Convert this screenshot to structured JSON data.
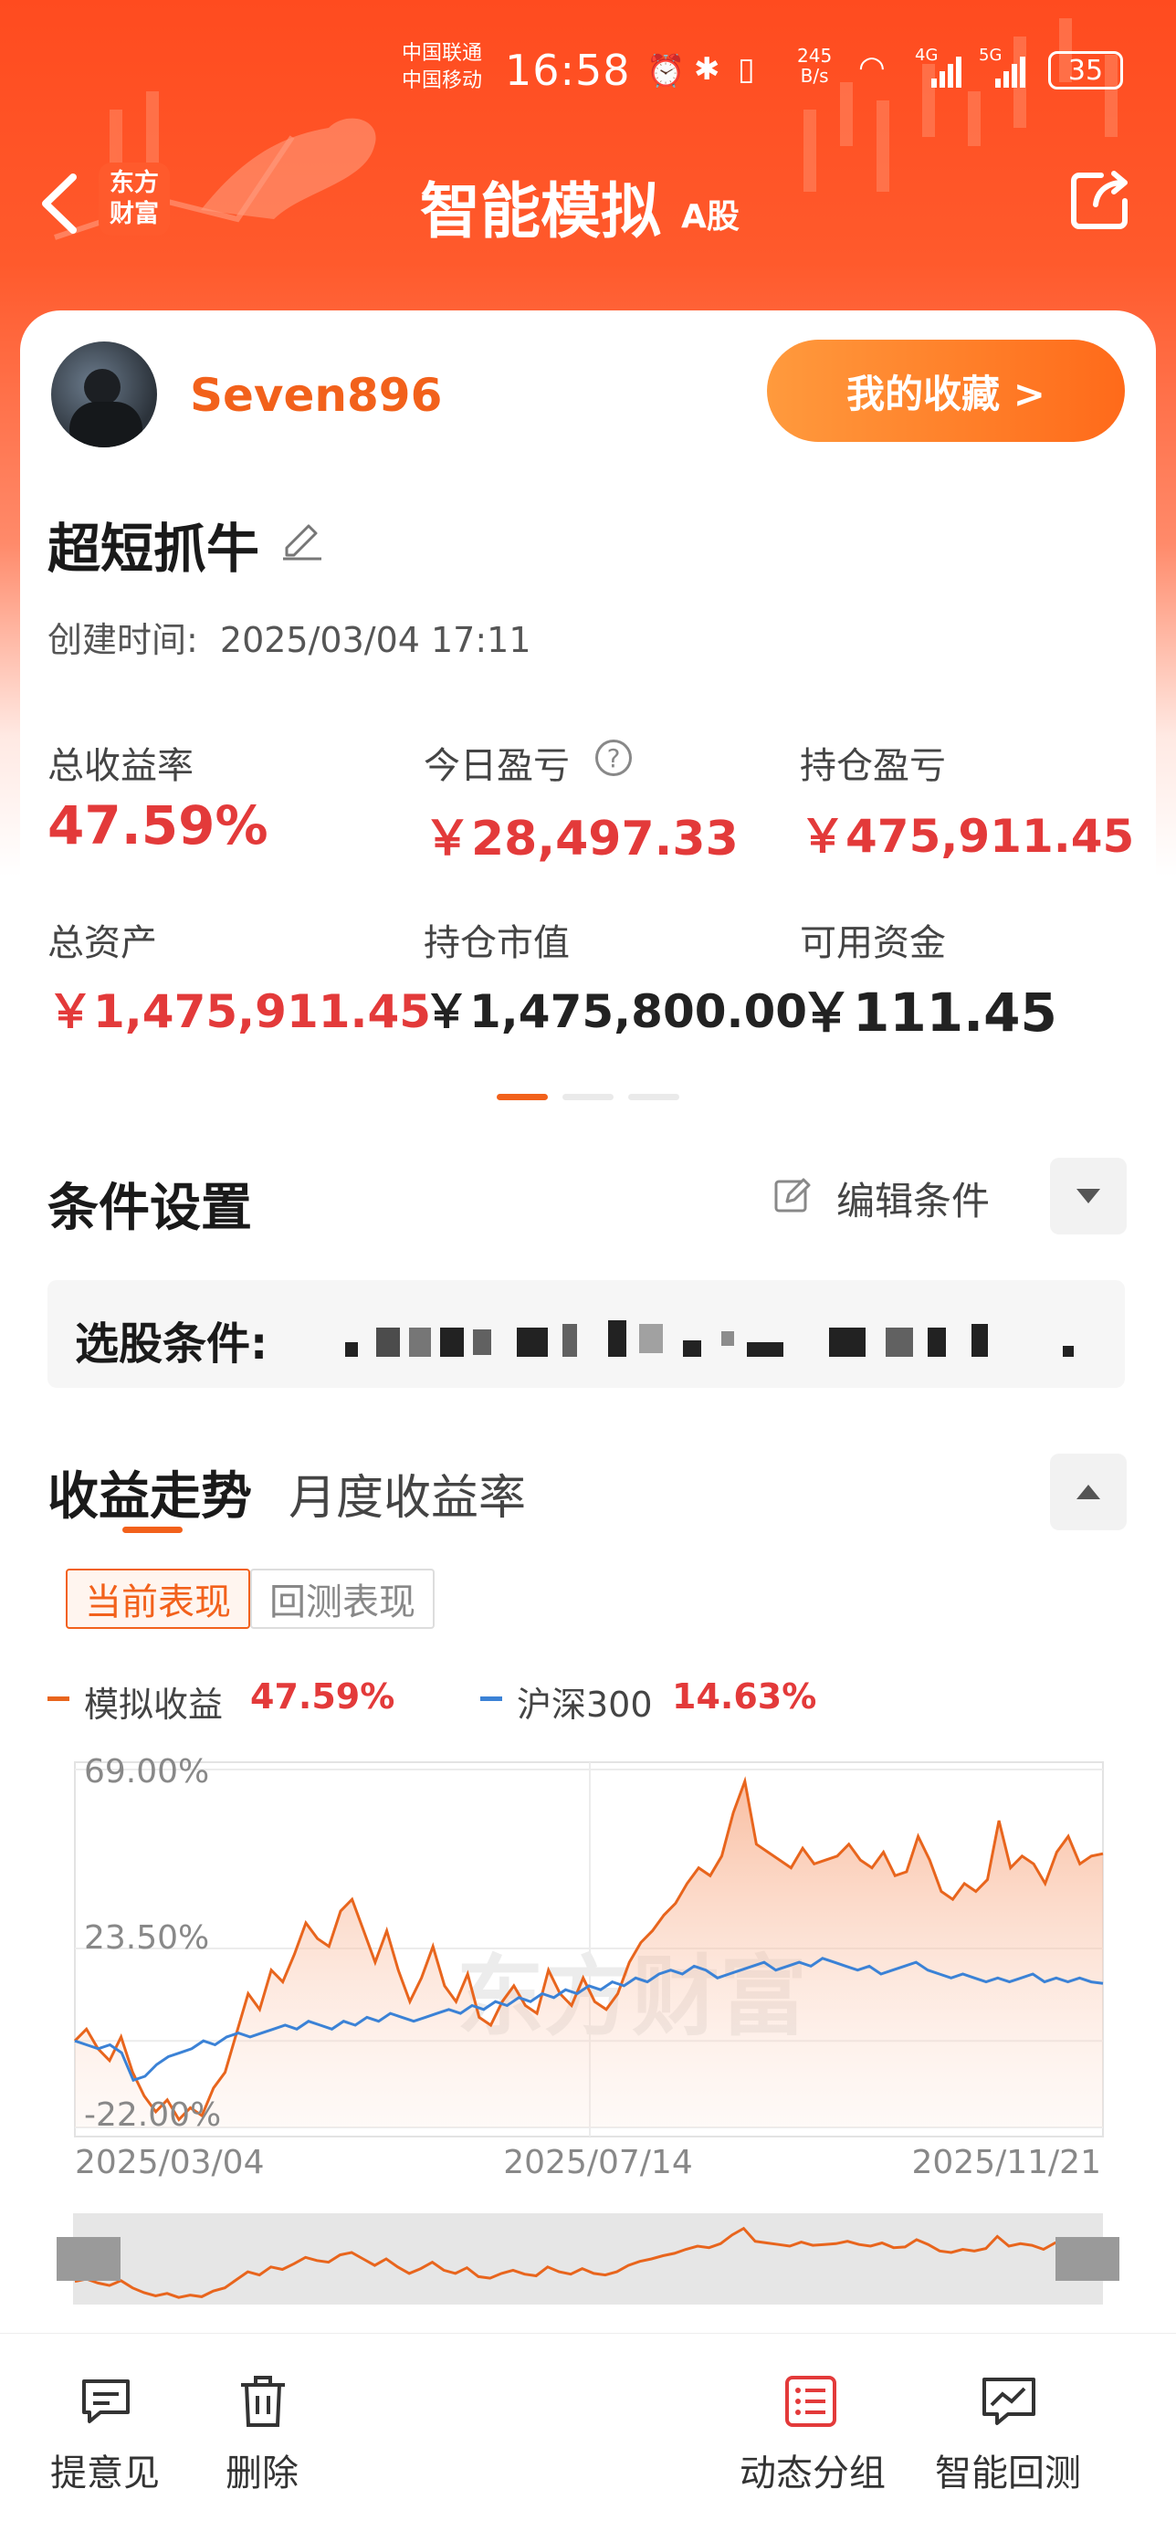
{
  "status_bar": {
    "carrier1": "中国联通",
    "carrier2": "中国移动",
    "time": "16:58",
    "net_speed_top": "245",
    "net_speed_bottom": "B/s",
    "sig1": "4G",
    "sig2": "5G",
    "battery": "35"
  },
  "nav": {
    "logo_line1": "东方",
    "logo_line2": "财富",
    "title": "智能模拟",
    "subtitle": "A股",
    "favorites_label": "我的收藏 >"
  },
  "profile": {
    "username": "Seven896",
    "strategy_name": "超短抓牛",
    "created_label": "创建时间:",
    "created_time": "2025/03/04 17:11"
  },
  "stats": [
    {
      "label": "总收益率",
      "value": "47.59%",
      "style": "red"
    },
    {
      "label": "今日盈亏",
      "value": "￥28,497.33",
      "style": "red"
    },
    {
      "label": "持仓盈亏",
      "value": "￥475,911.45",
      "style": "red"
    },
    {
      "label": "总资产",
      "value": "￥1,475,911.45",
      "style": "red"
    },
    {
      "label": "持仓市值",
      "value": "￥1,475,800.00",
      "style": "black"
    },
    {
      "label": "可用资金",
      "value": "￥111.45",
      "style": "black"
    }
  ],
  "conditions": {
    "title": "条件设置",
    "edit_label": "编辑条件",
    "select_label": "选股条件:"
  },
  "returns": {
    "tab_active": "收益走势",
    "tab_inactive": "月度收益率",
    "btn_current": "当前表现",
    "btn_backtest": "回测表现",
    "legend": [
      {
        "name": "模拟收益",
        "value": "47.59%",
        "color": "#e8651d"
      },
      {
        "name": "沪深300",
        "value": "14.63%",
        "color": "#3b82d6"
      }
    ],
    "watermark": "东方财富"
  },
  "chart_data": {
    "type": "line",
    "y_ticks": [
      "69.00%",
      "23.50%",
      "-22.00%"
    ],
    "x_ticks": [
      "2025/03/04",
      "2025/07/14",
      "2025/11/21"
    ],
    "ylim": [
      -22,
      69
    ],
    "series": [
      {
        "name": "模拟收益",
        "color": "#e8651d",
        "values": [
          0,
          3,
          -2,
          -5,
          1,
          -8,
          -14,
          -18,
          -15,
          -20,
          -17,
          -19,
          -12,
          -8,
          2,
          12,
          8,
          18,
          15,
          22,
          30,
          26,
          24,
          33,
          36,
          28,
          20,
          28,
          18,
          10,
          16,
          24,
          14,
          10,
          17,
          6,
          4,
          10,
          14,
          9,
          7,
          18,
          12,
          9,
          16,
          10,
          8,
          12,
          20,
          25,
          28,
          32,
          35,
          40,
          44,
          42,
          47,
          58,
          66,
          50,
          48,
          46,
          44,
          49,
          45,
          46,
          47,
          50,
          46,
          44,
          48,
          42,
          43,
          52,
          46,
          38,
          36,
          40,
          38,
          41,
          56,
          44,
          47,
          45,
          40,
          48,
          52,
          45,
          47,
          47.59
        ]
      },
      {
        "name": "沪深300",
        "color": "#3b82d6",
        "values": [
          0,
          -1,
          -2,
          -1,
          -3,
          -10,
          -9,
          -6,
          -4,
          -3,
          -2,
          0,
          -1,
          1,
          2,
          1,
          2,
          3,
          4,
          3,
          5,
          4,
          3,
          5,
          4,
          6,
          5,
          7,
          6,
          5,
          6,
          7,
          8,
          7,
          9,
          8,
          10,
          9,
          11,
          10,
          12,
          11,
          13,
          12,
          14,
          13,
          15,
          14,
          16,
          15,
          17,
          18,
          17,
          19,
          18,
          16,
          17,
          18,
          19,
          20,
          18,
          19,
          20,
          19,
          21,
          20,
          19,
          18,
          19,
          17,
          18,
          19,
          20,
          18,
          17,
          16,
          17,
          16,
          15,
          16,
          15,
          16,
          17,
          15,
          16,
          15,
          16,
          15,
          14.63
        ]
      }
    ]
  },
  "bottom_nav": {
    "feedback": "提意见",
    "delete": "删除",
    "group": "动态分组",
    "backtest": "智能回测"
  }
}
